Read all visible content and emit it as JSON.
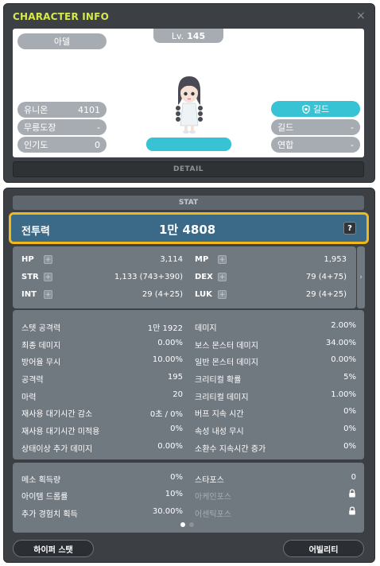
{
  "window": {
    "title": "CHARACTER INFO",
    "close": "×",
    "detail": "DETAIL"
  },
  "profile": {
    "name": "아델",
    "level_prefix": "Lv.",
    "level": "145",
    "left_rows": [
      {
        "label": "유니온",
        "value": "4101"
      },
      {
        "label": "무릉도장",
        "value": "-"
      },
      {
        "label": "인기도",
        "value": "0"
      }
    ],
    "guild_button": "길드",
    "right_rows": [
      {
        "label": "길드",
        "value": "-"
      },
      {
        "label": "연합",
        "value": "-"
      }
    ]
  },
  "stat": {
    "header": "STAT",
    "power_label": "전투력",
    "power_value": "1만 4808",
    "help": "?",
    "basic": [
      {
        "label": "HP",
        "value": "3,114"
      },
      {
        "label": "MP",
        "value": "1,953"
      },
      {
        "label": "STR",
        "value": "1,133 (743+390)"
      },
      {
        "label": "DEX",
        "value": "79 (4+75)"
      },
      {
        "label": "INT",
        "value": "29 (4+25)"
      },
      {
        "label": "LUK",
        "value": "29 (4+25)"
      }
    ],
    "details_left": [
      {
        "label": "스텟 공격력",
        "value": "1만 1922"
      },
      {
        "label": "최종 데미지",
        "value": "0.00%"
      },
      {
        "label": "방어율 무시",
        "value": "10.00%"
      },
      {
        "label": "공격력",
        "value": "195"
      },
      {
        "label": "마력",
        "value": "20"
      },
      {
        "label": "재사용 대기시간 감소",
        "value": "0초 / 0%"
      },
      {
        "label": "재사용 대기시간 미적용",
        "value": "0%"
      },
      {
        "label": "상태이상 추가 데미지",
        "value": "0.00%"
      }
    ],
    "details_right": [
      {
        "label": "데미지",
        "value": "2.00%"
      },
      {
        "label": "보스 몬스터 데미지",
        "value": "34.00%"
      },
      {
        "label": "일반 몬스터 데미지",
        "value": "0.00%"
      },
      {
        "label": "크리티컬 확률",
        "value": "5%"
      },
      {
        "label": "크리티컬 데미지",
        "value": "1.00%"
      },
      {
        "label": "버프 지속 시간",
        "value": "0%"
      },
      {
        "label": "속성 내성 무시",
        "value": "0%"
      },
      {
        "label": "소환수 지속시간 증가",
        "value": "0%"
      }
    ],
    "extra_left": [
      {
        "label": "메소 획득량",
        "value": "0%"
      },
      {
        "label": "아이템 드롭률",
        "value": "10%"
      },
      {
        "label": "추가 경험치 획득",
        "value": "30.00%"
      }
    ],
    "extra_right": [
      {
        "label": "스타포스",
        "value": "0"
      },
      {
        "label": "아케인포스",
        "value": ""
      },
      {
        "label": "어센틱포스",
        "value": ""
      }
    ],
    "hyper_button": "하이퍼 스탯",
    "ability_button": "어빌리티"
  },
  "colors": {
    "accent": "#38c3d4",
    "highlight": "#f0b81a",
    "title": "#d6e84a"
  },
  "icons": {
    "side_arrow": "›"
  }
}
